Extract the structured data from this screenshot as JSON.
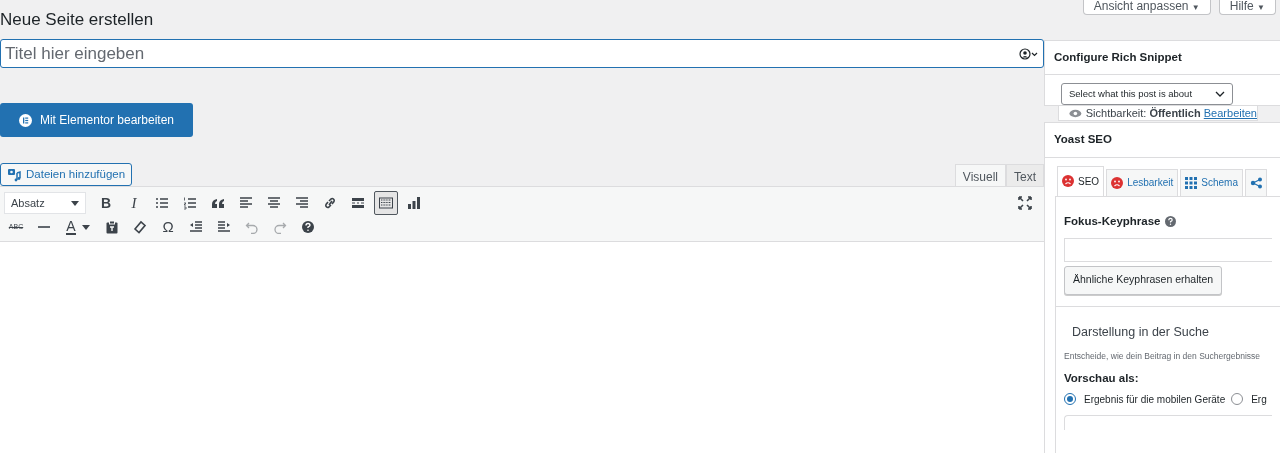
{
  "screen_options": [
    {
      "label": "Ansicht anpassen",
      "caret": "▼"
    },
    {
      "label": "Hilfe",
      "caret": "▼"
    }
  ],
  "page_title": "Neue Seite erstellen",
  "title_field": {
    "placeholder": "Titel hier eingeben"
  },
  "elementor_button": "Mit Elementor bearbeiten",
  "add_media_button": "Dateien hinzufügen",
  "editor_tabs": [
    {
      "label": "Visuell",
      "selected": true
    },
    {
      "label": "Text",
      "selected": false
    }
  ],
  "toolbar_rows": [
    [
      {
        "kind": "select",
        "label": "Absatz"
      },
      {
        "kind": "bold",
        "label": "B"
      },
      {
        "kind": "italic",
        "label": "I"
      },
      {
        "kind": "ul"
      },
      {
        "kind": "ol"
      },
      {
        "kind": "quote"
      },
      {
        "kind": "align-left"
      },
      {
        "kind": "align-center"
      },
      {
        "kind": "align-right"
      },
      {
        "kind": "link"
      },
      {
        "kind": "more"
      },
      {
        "kind": "toggle",
        "selected": true
      },
      {
        "kind": "chart"
      }
    ],
    [
      {
        "kind": "strike",
        "label": "ABC"
      },
      {
        "kind": "hr"
      },
      {
        "kind": "color",
        "label": "A"
      },
      {
        "kind": "paste"
      },
      {
        "kind": "eraser"
      },
      {
        "kind": "symbol",
        "label": "Ω"
      },
      {
        "kind": "outdent"
      },
      {
        "kind": "indent"
      },
      {
        "kind": "undo",
        "disabled": true
      },
      {
        "kind": "redo",
        "disabled": true
      },
      {
        "kind": "help"
      }
    ]
  ],
  "rich_snippet": {
    "title": "Configure Rich Snippet",
    "select": "Select what this post is about"
  },
  "visibility": {
    "label": "Sichtbarkeit:",
    "value": "Öffentlich",
    "link": "Bearbeiten"
  },
  "yoast": {
    "title": "Yoast SEO",
    "tabs": [
      {
        "label": "SEO",
        "kind": "sad",
        "selected": true
      },
      {
        "label": "Lesbarkeit",
        "kind": "sad",
        "selected": false
      },
      {
        "label": "Schema",
        "kind": "grid",
        "selected": false
      },
      {
        "kind": "share",
        "selected": false
      }
    ],
    "focus_label": "Fokus-Keyphrase",
    "related_button": "Ähnliche Keyphrasen erhalten",
    "search_heading": "Darstellung in der Suche",
    "search_hint": "Entscheide, wie dein Beitrag in den Suchergebnisse",
    "preview_label": "Vorschau als:",
    "preview_options": [
      {
        "label": "Ergebnis für die mobilen Geräte",
        "selected": true
      },
      {
        "label": "Erg",
        "selected": false
      }
    ]
  }
}
